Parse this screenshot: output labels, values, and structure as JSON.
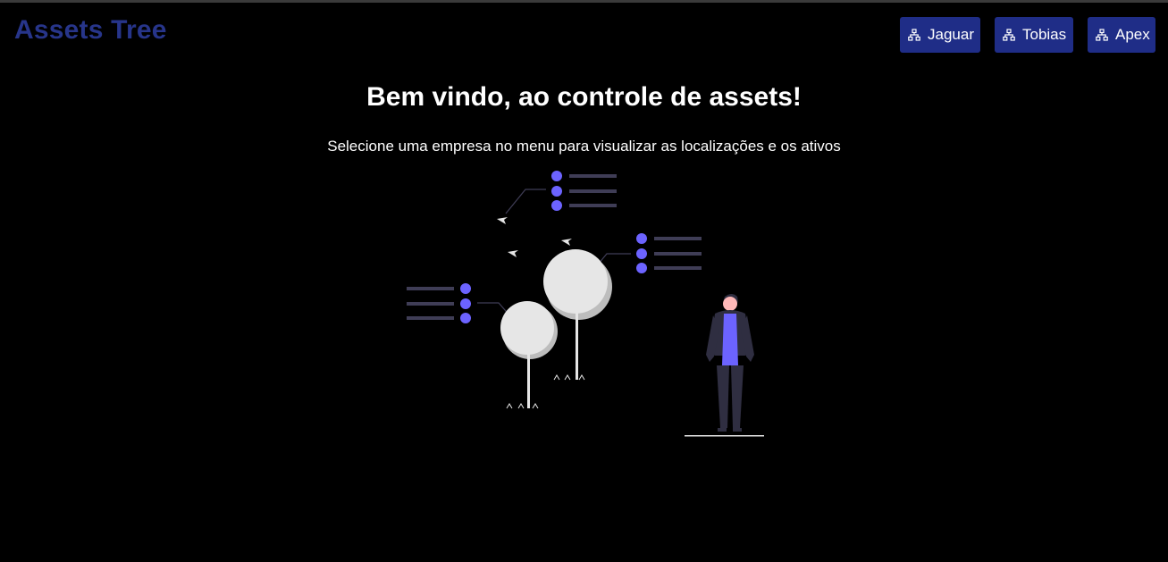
{
  "header": {
    "brand": "Assets Tree"
  },
  "nav": {
    "companies": [
      {
        "label": "Jaguar",
        "icon": "tree-icon"
      },
      {
        "label": "Tobias",
        "icon": "tree-icon"
      },
      {
        "label": "Apex",
        "icon": "tree-icon"
      }
    ]
  },
  "main": {
    "title": "Bem vindo, ao controle de assets!",
    "subtitle": "Selecione uma empresa no menu para visualizar as localizações e os ativos"
  },
  "colors": {
    "background": "#000000",
    "brand": "#27358a",
    "button": "#1f2d87",
    "accent": "#6c63ff",
    "list_line": "#3f3d56"
  }
}
